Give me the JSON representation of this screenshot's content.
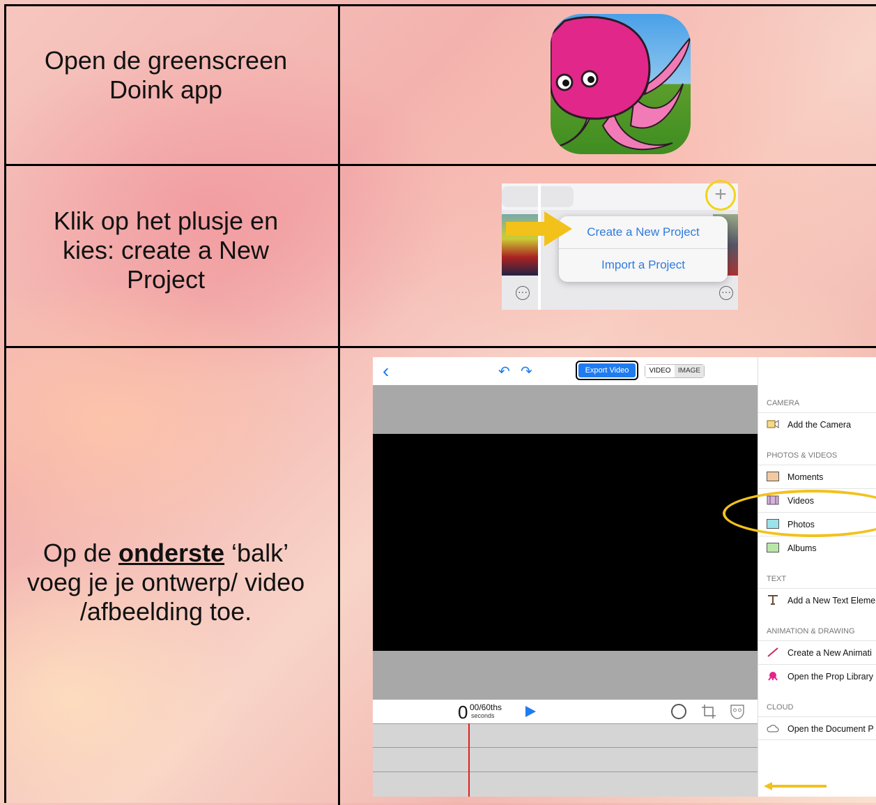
{
  "rows": [
    {
      "instruction": [
        "Open de greenscreen",
        "Doink app"
      ]
    },
    {
      "instruction": [
        "Klik op het plusje en",
        "kies: create a New",
        "Project"
      ]
    },
    {
      "instruction": {
        "pre": "Op de ",
        "emph": "onderste",
        "post": " ‘balk’",
        "line2": "voeg je je ontwerp/ video",
        "line3": "/afbeelding toe."
      }
    }
  ],
  "new_project_menu": {
    "items": [
      "Create a New Project",
      "Import a Project"
    ],
    "plus_symbol": "+",
    "more_symbol": "···"
  },
  "editor": {
    "back_symbol": "‹",
    "undo_symbol": "↶",
    "redo_symbol": "↷",
    "export_label": "Export Video",
    "mode_video": "VIDEO",
    "mode_image": "IMAGE",
    "time_big": "0",
    "time_fraction": "00/60ths",
    "time_unit": "seconds",
    "sidebar": {
      "camera_header": "CAMERA",
      "add_camera": "Add the Camera",
      "photos_header": "PHOTOS & VIDEOS",
      "moments": "Moments",
      "videos": "Videos",
      "photos": "Photos",
      "albums": "Albums",
      "text_header": "TEXT",
      "add_text": "Add a New Text Eleme",
      "anim_header": "ANIMATION & DRAWING",
      "new_animation": "Create a New Animati",
      "prop_library": "Open the Prop Library",
      "cloud_header": "CLOUD",
      "document": "Open the Document P"
    }
  },
  "colors": {
    "highlight_yellow": "#f2c21b",
    "ios_blue": "#1f7cf0",
    "playhead_red": "#e02020",
    "octopus_pink": "#e2278a"
  }
}
